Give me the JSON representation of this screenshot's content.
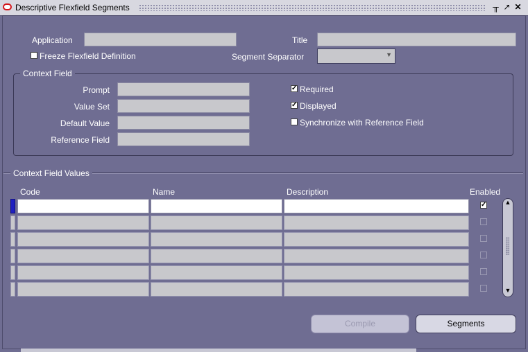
{
  "window": {
    "title": "Descriptive Flexfield Segments",
    "controls": [
      "minimize-icon",
      "maximize-icon",
      "close-icon"
    ]
  },
  "header": {
    "application_label": "Application",
    "application_value": "",
    "title_label": "Title",
    "title_value": "",
    "freeze_label": "Freeze Flexfield Definition",
    "freeze_checked": false,
    "separator_label": "Segment Separator",
    "separator_value": ""
  },
  "context_field": {
    "legend": "Context Field",
    "prompt_label": "Prompt",
    "value_set_label": "Value Set",
    "default_value_label": "Default Value",
    "reference_field_label": "Reference Field",
    "required_label": "Required",
    "required_checked": true,
    "displayed_label": "Displayed",
    "displayed_checked": true,
    "sync_label": "Synchronize with Reference Field",
    "sync_checked": false
  },
  "values": {
    "legend": "Context Field Values",
    "columns": [
      "Code",
      "Name",
      "Description",
      "Enabled"
    ],
    "rows": [
      {
        "code": "",
        "name": "",
        "description": "",
        "enabled": true
      },
      {
        "code": "",
        "name": "",
        "description": "",
        "enabled": false
      },
      {
        "code": "",
        "name": "",
        "description": "",
        "enabled": false
      },
      {
        "code": "",
        "name": "",
        "description": "",
        "enabled": false
      },
      {
        "code": "",
        "name": "",
        "description": "",
        "enabled": false
      },
      {
        "code": "",
        "name": "",
        "description": "",
        "enabled": false
      }
    ]
  },
  "buttons": {
    "compile": "Compile",
    "segments": "Segments"
  },
  "colors": {
    "background": "#6f6d92",
    "field": "#c8c8cc",
    "logo": "#d4161b"
  }
}
